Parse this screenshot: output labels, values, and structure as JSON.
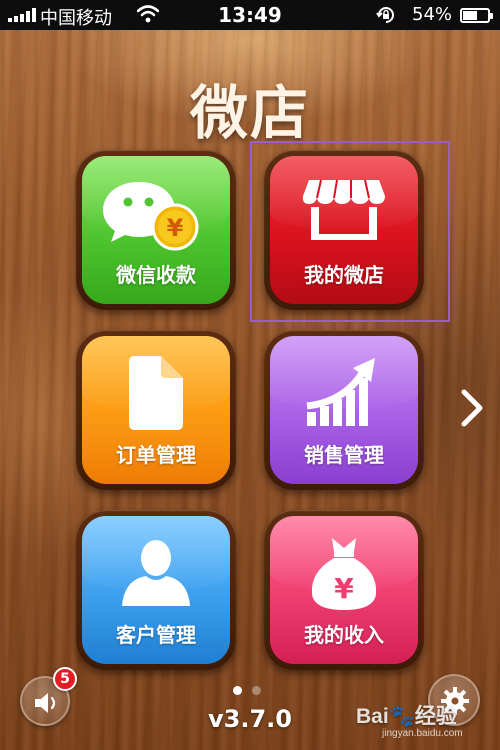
{
  "status_bar": {
    "carrier": "中国移动",
    "time": "13:49",
    "battery_percent": "54%",
    "battery_level": 0.54,
    "signal_bars": 5,
    "icons": [
      "signal-icon",
      "wifi-icon",
      "rotation-lock-icon",
      "battery-icon"
    ]
  },
  "app": {
    "title": "微店",
    "version": "v3.7.0"
  },
  "tiles": [
    {
      "label": "微信收款",
      "icon": "wechat-yuan-icon",
      "color": "#4fc42e"
    },
    {
      "label": "我的微店",
      "icon": "storefront-icon",
      "color": "#d9121e"
    },
    {
      "label": "订单管理",
      "icon": "document-icon",
      "color": "#fb9a12"
    },
    {
      "label": "销售管理",
      "icon": "growth-chart-icon",
      "color": "#a95fe6"
    },
    {
      "label": "客户管理",
      "icon": "person-icon",
      "color": "#3c9fee"
    },
    {
      "label": "我的收入",
      "icon": "money-bag-icon",
      "color": "#ef3d70"
    }
  ],
  "pager": {
    "pages": 2,
    "current": 1
  },
  "sound": {
    "badge_count": "5"
  },
  "watermark": {
    "main": "Bai",
    "mid": "经验",
    "sub": "jingyan.baidu.com"
  },
  "colors": {
    "highlight": "#9b5fc4",
    "badge": "#e31d24"
  }
}
